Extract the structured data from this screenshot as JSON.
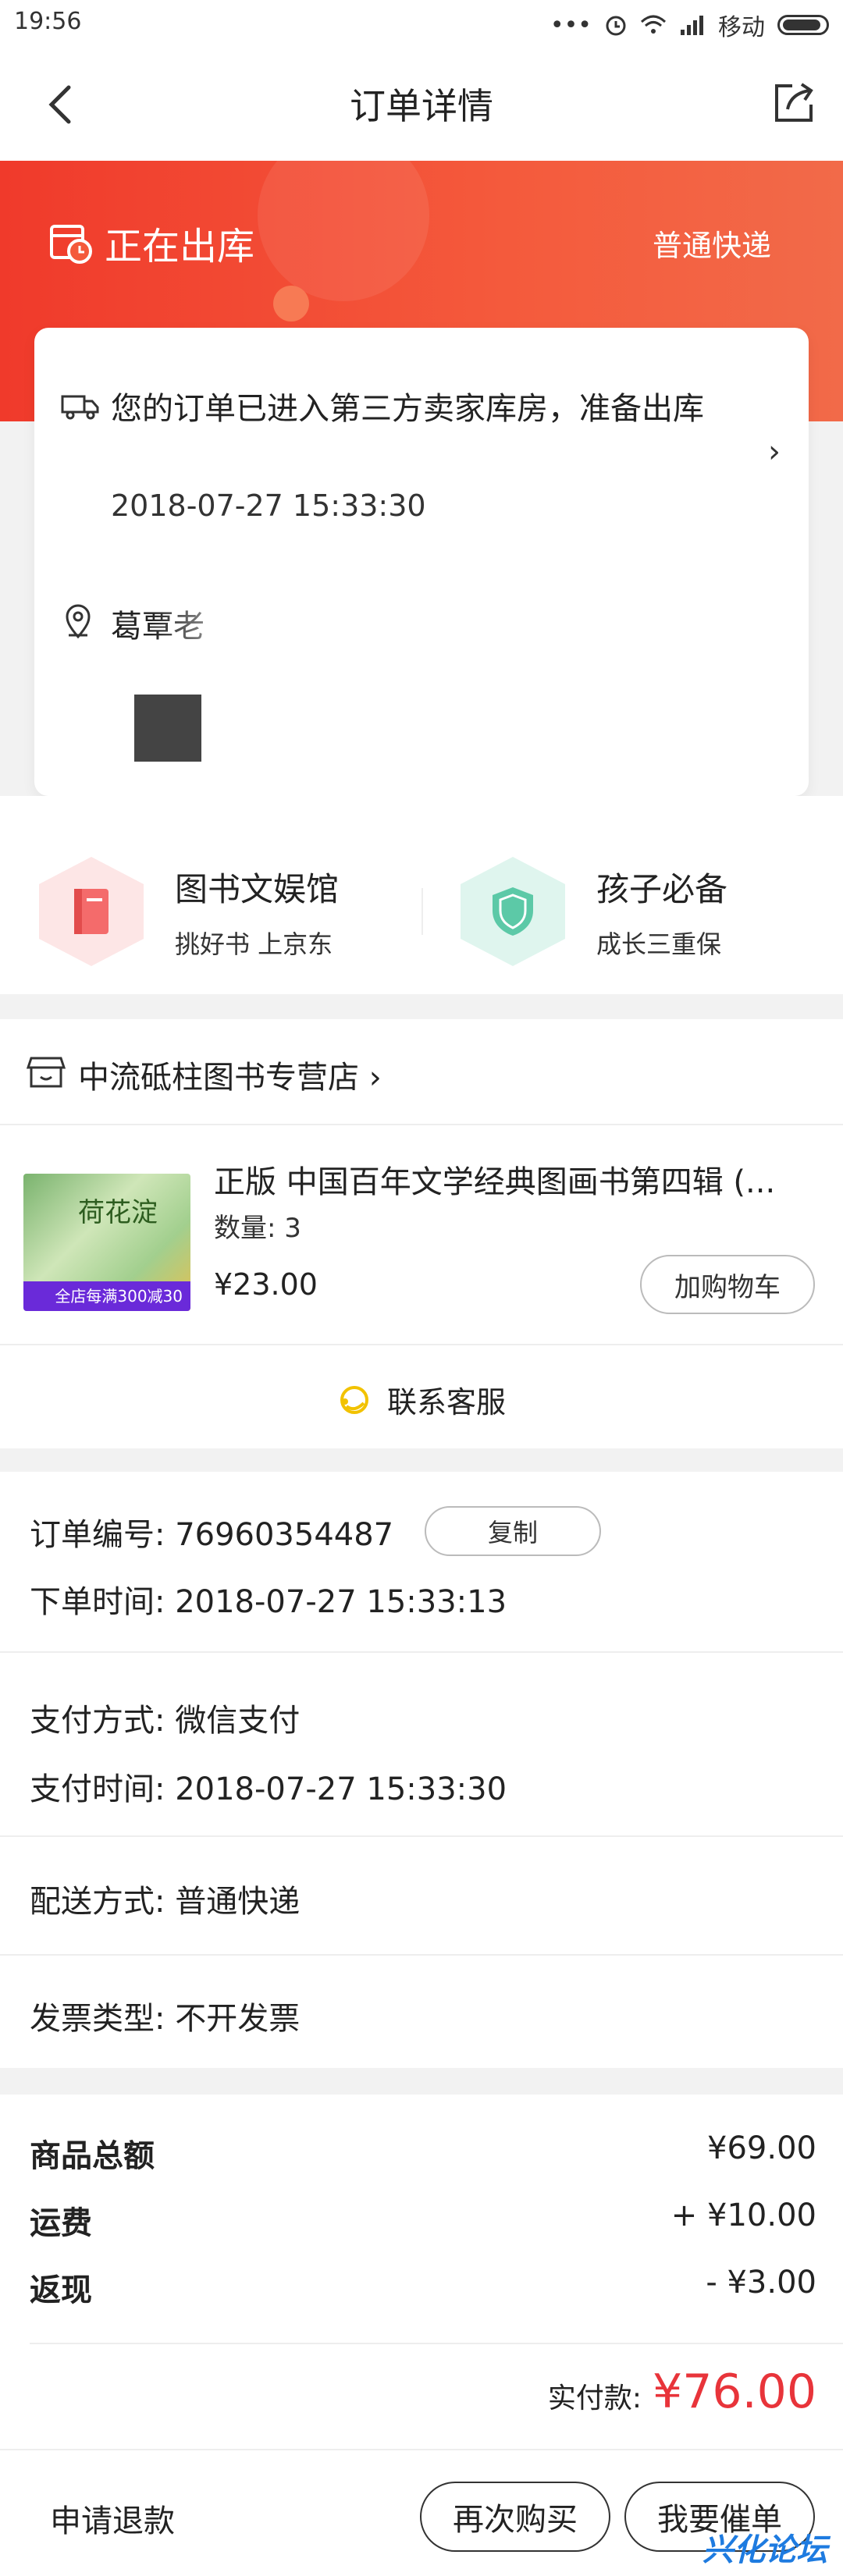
{
  "status_bar": {
    "time": "19:56",
    "dots": "•••",
    "carrier": "移动"
  },
  "header": {
    "title": "订单详情"
  },
  "hero": {
    "status": "正在出库",
    "delivery": "普通快递"
  },
  "logistics": {
    "message": "您的订单已进入第三方卖家库房，准备出库",
    "time": "2018-07-27 15:33:30",
    "arrow": "›",
    "address": "葛覃老"
  },
  "promos": [
    {
      "title": "图书文娱馆",
      "subtitle": "挑好书 上京东",
      "color": "#f46b6b"
    },
    {
      "title": "孩子必备",
      "subtitle": "成长三重保",
      "color": "#5cc9a7"
    }
  ],
  "store": {
    "name": "中流砥柱图书专营店 ›"
  },
  "product": {
    "title": "正版 中国百年文学经典图画书第四辑 (...",
    "quantity": "数量: 3",
    "price": "¥23.00",
    "cart_button": "加购物车",
    "cover_text": "荷花淀",
    "badge": "全店每满300减30"
  },
  "service": {
    "label": "联系客服"
  },
  "order_info": {
    "order_no": "订单编号: 76960354487",
    "copy_button": "复制",
    "order_time": "下单时间: 2018-07-27 15:33:13",
    "pay_method": "支付方式: 微信支付",
    "pay_time": "支付时间: 2018-07-27 15:33:30",
    "delivery_method": "配送方式: 普通快递",
    "invoice_type": "发票类型: 不开发票"
  },
  "totals": {
    "items": [
      {
        "label": "商品总额",
        "value": "¥69.00"
      },
      {
        "label": "运费",
        "value": "+ ¥10.00"
      },
      {
        "label": "返现",
        "value": "- ¥3.00"
      }
    ],
    "paid_label": "实付款:",
    "paid_value": "¥76.00"
  },
  "bottom_bar": {
    "refund": "申请退款",
    "rebuy": "再次购买",
    "urge": "我要催单"
  },
  "watermark": "兴化论坛",
  "colors": {
    "accent": "#f03a2b",
    "price": "#e8343a"
  }
}
